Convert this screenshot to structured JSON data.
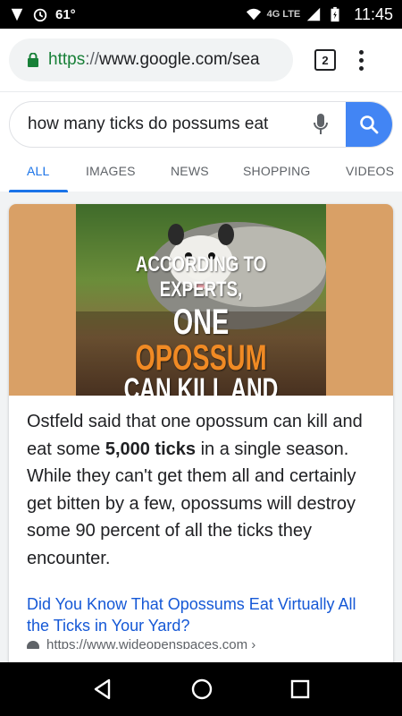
{
  "status_bar": {
    "temperature": "61°",
    "network": "4G LTE",
    "time": "11:45"
  },
  "browser": {
    "url_scheme": "https",
    "url_rest": "www.google.com/sea",
    "tab_count": "2"
  },
  "search": {
    "query": "how many ticks do possums eat"
  },
  "tabs": [
    {
      "label": "ALL",
      "active": true
    },
    {
      "label": "IMAGES",
      "active": false
    },
    {
      "label": "NEWS",
      "active": false
    },
    {
      "label": "SHOPPING",
      "active": false
    },
    {
      "label": "VIDEOS",
      "active": false
    }
  ],
  "result": {
    "image_caption_line1": "ACCORDING TO EXPERTS,",
    "image_caption_line2_a": "ONE ",
    "image_caption_line2_b": "OPOSSUM",
    "image_caption_line3": "CAN KILL AND EAT",
    "snippet_before": "Ostfeld said that one opossum can kill and eat some ",
    "snippet_bold": "5,000 ticks",
    "snippet_after": " in a single season. While they can't get them all and certainly get bitten by a few, opossums will destroy some 90 percent of all the ticks they encounter.",
    "link_title": "Did You Know That Opossums Eat Virtually All the Ticks in Your Yard?",
    "source_url": "https://www.wideopenspaces.com ›"
  },
  "colors": {
    "accent": "#1a73e8",
    "search_button": "#4285f4",
    "image_background": "#d9a066",
    "caption_highlight": "#f08a24"
  }
}
